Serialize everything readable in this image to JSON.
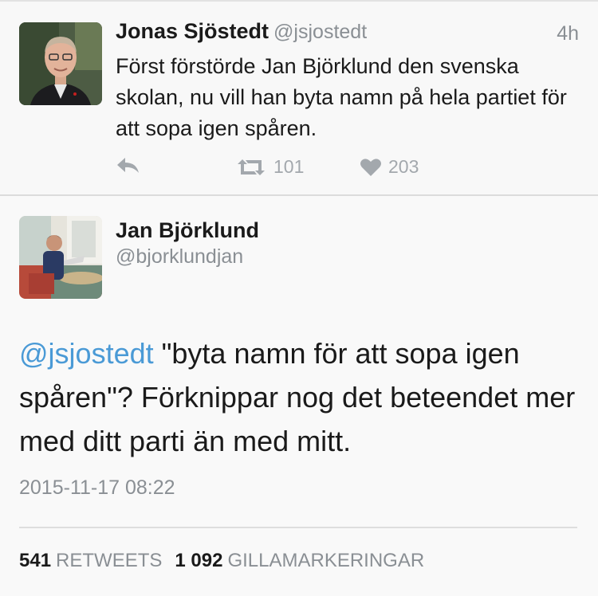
{
  "tweet1": {
    "author_name": "Jonas Sjöstedt",
    "author_handle": "@jsjostedt",
    "time": "4h",
    "text": "Först förstörde Jan Björklund den svenska skolan, nu vill han byta namn på hela partiet för att sopa igen spåren.",
    "actions": {
      "reply_icon": "reply-icon",
      "retweet_icon": "retweet-icon",
      "retweet_count": "101",
      "like_icon": "heart-icon",
      "like_count": "203"
    }
  },
  "tweet2": {
    "author_name": "Jan Björklund",
    "author_handle": "@bjorklundjan",
    "mention": "@jsjostedt",
    "text": " \"byta namn för att sopa igen spåren\"? Förknippar nog det beteendet mer med ditt parti än med mitt.",
    "timestamp": "2015-11-17 08:22",
    "retweets_count": "541",
    "retweets_label": "RETWEETS",
    "likes_count": "1 092",
    "likes_label": "GILLAMARKERINGAR"
  },
  "colors": {
    "mention": "#4a9ad6",
    "muted": "#8a8f94",
    "text": "#1a1a1a",
    "icon": "#a3a8ad"
  }
}
